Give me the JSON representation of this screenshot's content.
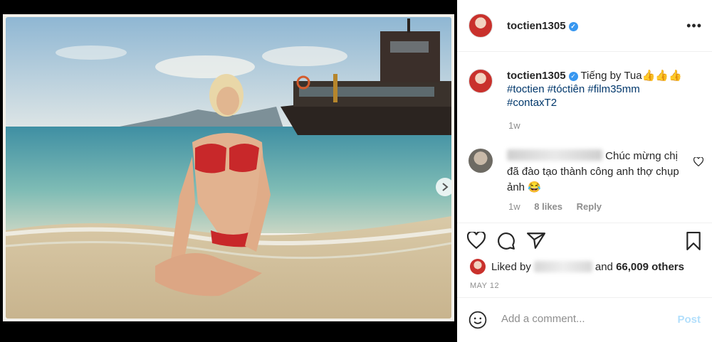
{
  "post": {
    "username": "toctien1305",
    "verified_icon": "verified-badge-icon",
    "more_icon": "more-options-icon",
    "media_dots_count": 4,
    "active_dot": 0
  },
  "caption": {
    "username": "toctien1305",
    "text": "Tiếng by Tua👍👍👍",
    "tags_line1": "#toctien #tóctiên #film35mm",
    "tags_line2": "#contaxT2",
    "time": "1w"
  },
  "comment": {
    "text": "Chúc mừng chị đã đào tạo thành công anh thợ chụp ảnh 😂",
    "time": "1w",
    "likes": "8 likes",
    "reply": "Reply"
  },
  "likes": {
    "prefix": "Liked by",
    "connector": "and",
    "others": "66,009 others"
  },
  "date": "MAY 12",
  "add_comment": {
    "placeholder": "Add a comment...",
    "post_label": "Post"
  },
  "colors": {
    "accent": "#3897f0",
    "link": "#00376b",
    "post_disabled": "#b2dffc"
  }
}
